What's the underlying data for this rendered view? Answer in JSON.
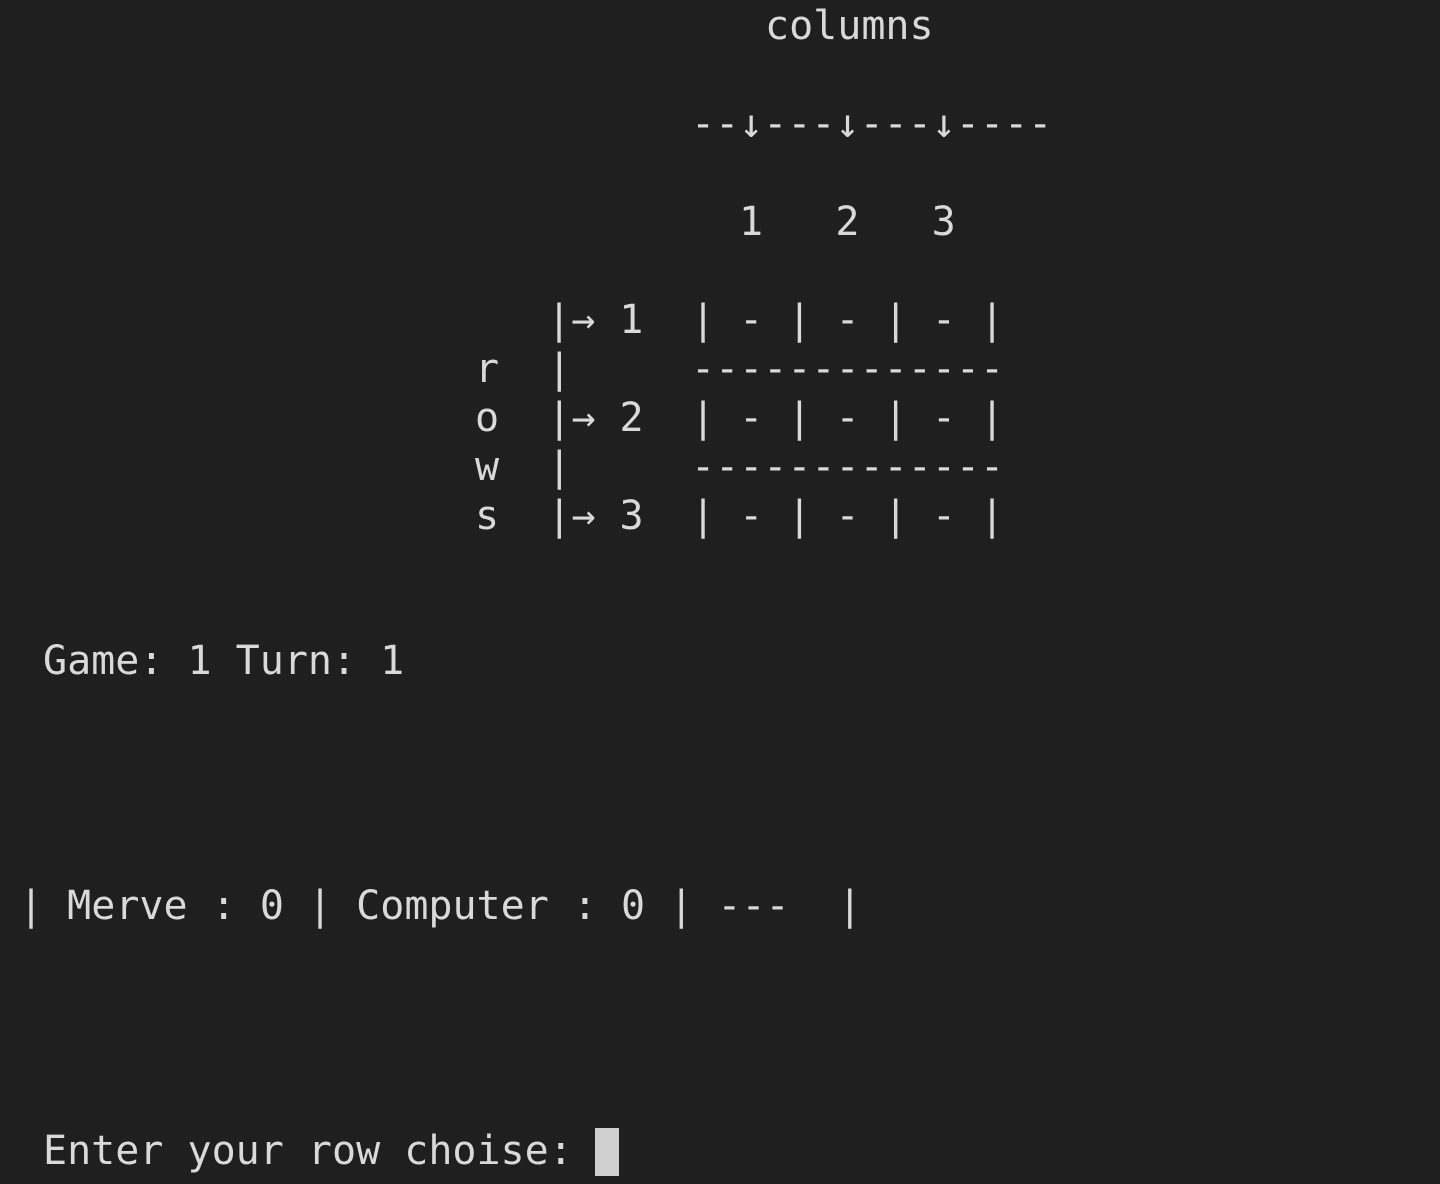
{
  "terminal": {
    "header": {
      "columns_title": "columns",
      "arrow_line": "--↓---↓---↓----",
      "column_numbers": "1   2   3"
    },
    "board": {
      "row1_prefix": "|→ 1",
      "row1_cells": "| - | - | - |",
      "sep1_label": "r  |",
      "sep1_line": "-------------",
      "row2_prefix": "o  |→ 2",
      "row2_cells": "| - | - | - |",
      "sep2_label": "w  |",
      "sep2_line": "-------------",
      "row3_prefix": "s  |→ 3",
      "row3_cells": "| - | - | - |"
    },
    "status": {
      "game_turn": "Game: 1 Turn: 1",
      "scoreboard": "| Merve : 0 | Computer : 0 | ---  |"
    },
    "prompt": {
      "text": "Enter your row choise: ",
      "input_value": ""
    }
  }
}
